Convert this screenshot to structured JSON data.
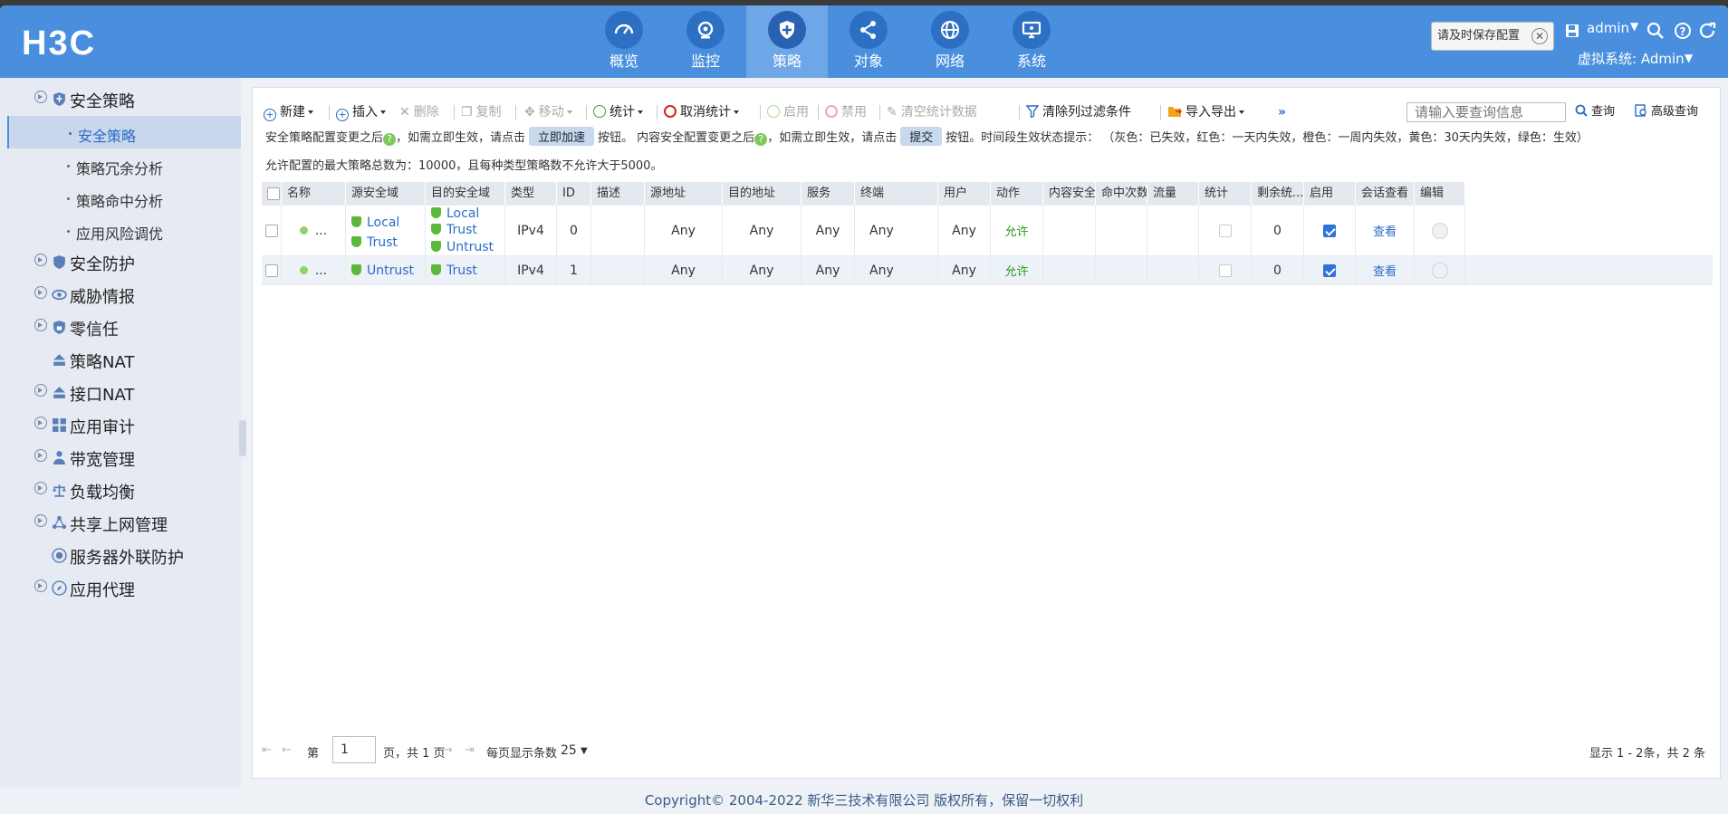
{
  "brand": "H3C",
  "nav": [
    {
      "label": "概览",
      "icon": "dashboard-icon"
    },
    {
      "label": "监控",
      "icon": "camera-icon"
    },
    {
      "label": "策略",
      "icon": "shield-icon"
    },
    {
      "label": "对象",
      "icon": "share-icon"
    },
    {
      "label": "网络",
      "icon": "globe-icon"
    },
    {
      "label": "系统",
      "icon": "monitor-icon"
    }
  ],
  "topright": {
    "tooltip": "请及时保存配置",
    "user": "admin",
    "vsys": "虚拟系统: Admin"
  },
  "sidebar": {
    "items": [
      {
        "label": "安全策略"
      },
      {
        "label": "安全防护"
      },
      {
        "label": "威胁情报"
      },
      {
        "label": "零信任"
      },
      {
        "label": "策略NAT"
      },
      {
        "label": "接口NAT"
      },
      {
        "label": "应用审计"
      },
      {
        "label": "带宽管理"
      },
      {
        "label": "负载均衡"
      },
      {
        "label": "共享上网管理"
      },
      {
        "label": "服务器外联防护"
      },
      {
        "label": "应用代理"
      }
    ],
    "subitems": [
      {
        "label": "安全策略"
      },
      {
        "label": "策略冗余分析"
      },
      {
        "label": "策略命中分析"
      },
      {
        "label": "应用风险调优"
      }
    ]
  },
  "toolbar": {
    "new": "新建",
    "insert": "插入",
    "delete": "删除",
    "copy": "复制",
    "move": "移动",
    "stats": "统计",
    "cancel_stats": "取消统计",
    "enable": "启用",
    "disable": "禁用",
    "clear_stats": "清空统计数据",
    "clear_filter": "清除列过滤条件",
    "import_export": "导入导出",
    "more": "»",
    "search_placeholder": "请输入要查询信息",
    "query": "查询",
    "advanced": "高级查询"
  },
  "info": {
    "line1a": "安全策略配置变更之后",
    "line1b": "，如需立即生效，请点击",
    "accelerate": "立即加速",
    "line1c": "按钮。 内容安全配置变更之后",
    "line1d": "，如需立即生效，请点击",
    "submit": "提交",
    "line1e": "按钮。时间段生效状态提示： （灰色：已失效，红色：一天内失效，橙色：一周内失效，黄色：30天内失效，绿色：生效）",
    "line2": "允许配置的最大策略总数为：10000，且每种类型策略数不允许大于5000。"
  },
  "table": {
    "headers": [
      "名称",
      "源安全域",
      "目的安全域",
      "类型",
      "ID",
      "描述",
      "源地址",
      "目的地址",
      "服务",
      "终端",
      "用户",
      "动作",
      "内容安全",
      "命中次数",
      "流量",
      "统计",
      "剩余统...",
      "启用",
      "会话查看",
      "编辑"
    ],
    "rows": [
      {
        "name": "...",
        "src_zones": [
          "Local",
          "Trust"
        ],
        "dst_zones": [
          "Local",
          "Trust",
          "Untrust"
        ],
        "type": "IPv4",
        "id": "0",
        "desc": "",
        "src_addr": "Any",
        "dst_addr": "Any",
        "service": "Any",
        "terminal": "Any",
        "user": "Any",
        "action": "允许",
        "remaining": "0",
        "enabled": true,
        "view": "查看"
      },
      {
        "name": "...",
        "src_zones": [
          "Untrust"
        ],
        "dst_zones": [
          "Trust"
        ],
        "type": "IPv4",
        "id": "1",
        "desc": "",
        "src_addr": "Any",
        "dst_addr": "Any",
        "service": "Any",
        "terminal": "Any",
        "user": "Any",
        "action": "允许",
        "remaining": "0",
        "enabled": true,
        "view": "查看"
      }
    ]
  },
  "pager": {
    "page_prefix": "第",
    "page_value": "1",
    "page_suffix": "页，共 1 页",
    "per_page_label": "每页显示条数",
    "per_page": "25",
    "summary": "显示 1 - 2条，共 2 条"
  },
  "footer": "Copyright© 2004-2022 新华三技术有限公司 版权所有，保留一切权利"
}
